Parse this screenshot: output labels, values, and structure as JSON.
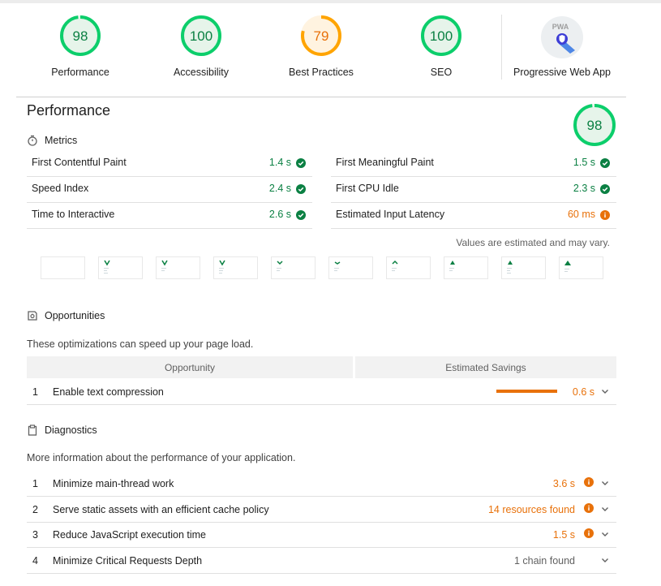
{
  "colors": {
    "pass": "#0b8043",
    "average": "#e8710a",
    "pass_ring": "#0cce6b",
    "avg_ring": "#ffa400",
    "text": "#212121",
    "muted": "#616161"
  },
  "categories": [
    {
      "score": "98",
      "label": "Performance",
      "fraction": 0.98,
      "status": "pass"
    },
    {
      "score": "100",
      "label": "Accessibility",
      "fraction": 1.0,
      "status": "pass"
    },
    {
      "score": "79",
      "label": "Best Practices",
      "fraction": 0.79,
      "status": "average"
    },
    {
      "score": "100",
      "label": "SEO",
      "fraction": 1.0,
      "status": "pass"
    }
  ],
  "pwa": {
    "badge": "PWA",
    "label": "Progressive Web App",
    "icon": "pwa-badge-icon"
  },
  "performance": {
    "title": "Performance",
    "score": "98",
    "fraction": 0.98
  },
  "metrics": {
    "heading": "Metrics",
    "icon": "stopwatch-icon",
    "items": [
      {
        "name": "First Contentful Paint",
        "value": "1.4 s",
        "status": "pass"
      },
      {
        "name": "First Meaningful Paint",
        "value": "1.5 s",
        "status": "pass"
      },
      {
        "name": "Speed Index",
        "value": "2.4 s",
        "status": "pass"
      },
      {
        "name": "First CPU Idle",
        "value": "2.3 s",
        "status": "pass"
      },
      {
        "name": "Time to Interactive",
        "value": "2.6 s",
        "status": "pass"
      },
      {
        "name": "Estimated Input Latency",
        "value": "60 ms",
        "status": "average"
      }
    ],
    "note": "Values are estimated and may vary."
  },
  "opportunities": {
    "heading": "Opportunities",
    "icon": "opportunity-icon",
    "description": "These optimizations can speed up your page load.",
    "col_opportunity": "Opportunity",
    "col_savings": "Estimated Savings",
    "items": [
      {
        "num": "1",
        "title": "Enable text compression",
        "value": "0.6 s"
      }
    ]
  },
  "diagnostics": {
    "heading": "Diagnostics",
    "icon": "clipboard-icon",
    "description": "More information about the performance of your application.",
    "items": [
      {
        "num": "1",
        "title": "Minimize main-thread work",
        "value": "3.6 s",
        "status": "average"
      },
      {
        "num": "2",
        "title": "Serve static assets with an efficient cache policy",
        "value": "14 resources found",
        "status": "average"
      },
      {
        "num": "3",
        "title": "Reduce JavaScript execution time",
        "value": "1.5 s",
        "status": "average"
      },
      {
        "num": "4",
        "title": "Minimize Critical Requests Depth",
        "value": "1 chain found",
        "status": "info"
      }
    ]
  }
}
